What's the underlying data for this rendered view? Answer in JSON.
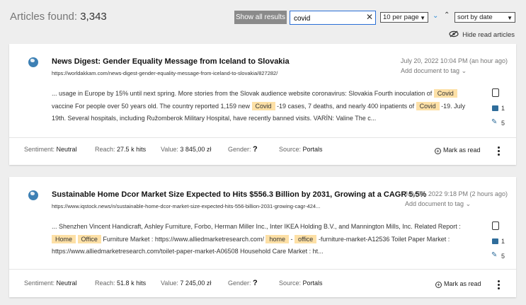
{
  "header": {
    "found_label": "Articles found:",
    "found_count": "3,343",
    "show_all_label": "Show all results",
    "search_value": "covid",
    "per_page": "10 per page",
    "sort_by": "sort by date",
    "hide_read_label": "Hide read articles"
  },
  "articles": [
    {
      "title": "News Digest: Gender Equality Message from Iceland to Slovakia",
      "url": "https://worldakkam.com/news-digest-gender-equality-message-from-iceland-to-slovakia/827282/",
      "date": "July 20, 2022 10:04 PM (an hour ago)",
      "add_tag": "Add document to tag",
      "snippet": [
        {
          "t": "... usage in Europe by 15% until next spring. More stories from the Slovak audience website coronavirus: Slovakia Fourth inoculation of ",
          "hl": false
        },
        {
          "t": "Covid",
          "hl": true
        },
        {
          "t": " vaccine For people over 50 years old. The country reported 1,159 new ",
          "hl": false
        },
        {
          "t": "Covid",
          "hl": true
        },
        {
          "t": " -19 cases, 7 deaths, and nearly 400 inpatients of ",
          "hl": false
        },
        {
          "t": "Covid",
          "hl": true
        },
        {
          "t": " -19. July 19th. Several hospitals, including Ružomberok Military Hospital, have recently banned visits. VARÍN: Valine The c...",
          "hl": false
        }
      ],
      "images": "1",
      "edits": "5",
      "sentiment_label": "Sentiment:",
      "sentiment": "Neutral",
      "reach_label": "Reach:",
      "reach": "27.5 k hits",
      "value_label": "Value:",
      "value": "3 845,00 zł",
      "gender_label": "Gender:",
      "gender": "?",
      "source_label": "Source:",
      "source": "Portals",
      "mark_read": "Mark as read"
    },
    {
      "title": "Sustainable Home Dcor Market Size Expected to Hits $556.3 Billion by 2031, Growing at a CAGR 5.5%",
      "url": "https://www.iqstock.news/n/sustainable-home-dcor-market-size-expected-hits-556-billion-2031-growing-cagr-424...",
      "date": "July 20, 2022 9:18 PM (2 hours ago)",
      "add_tag": "Add document to tag",
      "snippet": [
        {
          "t": "... Shenzhen Vincent Handicraft, Ashley Furniture, Forbo, Herman Miller Inc., Inter IKEA Holding B.V., and Mannington Mills, Inc. Related Report : ",
          "hl": false
        },
        {
          "t": "Home",
          "hl": true
        },
        {
          "t": " ",
          "hl": false
        },
        {
          "t": "Office",
          "hl": true
        },
        {
          "t": " Furniture Market : https://www.alliedmarketresearch.com/ ",
          "hl": false
        },
        {
          "t": "home",
          "hl": true
        },
        {
          "t": " - ",
          "hl": false
        },
        {
          "t": "office",
          "hl": true
        },
        {
          "t": " -furniture-market-A12536 Toilet Paper Market : https://www.alliedmarketresearch.com/toilet-paper-market-A06508 Household Care Market : ht...",
          "hl": false
        }
      ],
      "images": "1",
      "edits": "5",
      "sentiment_label": "Sentiment:",
      "sentiment": "Neutral",
      "reach_label": "Reach:",
      "reach": "51.8 k hits",
      "value_label": "Value:",
      "value": "7 245,00 zł",
      "gender_label": "Gender:",
      "gender": "?",
      "source_label": "Source:",
      "source": "Portals",
      "mark_read": "Mark as read"
    }
  ]
}
